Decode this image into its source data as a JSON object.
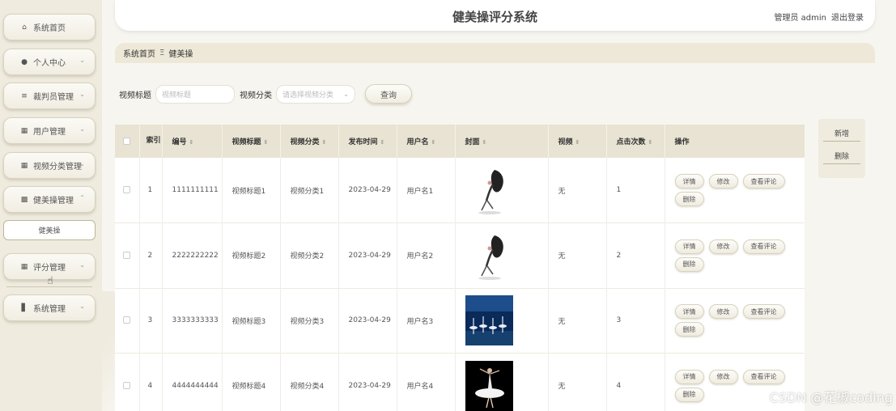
{
  "header": {
    "title": "健美操评分系统",
    "user_label": "管理员 admin",
    "logout": "退出登录"
  },
  "sidebar": {
    "items": [
      {
        "label": "系统首页",
        "icon": "home-icon"
      },
      {
        "label": "个人中心",
        "icon": "user-icon"
      },
      {
        "label": "裁判员管理",
        "icon": "list-icon"
      },
      {
        "label": "用户管理",
        "icon": "grid-icon"
      },
      {
        "label": "视频分类管理",
        "icon": "grid-icon"
      },
      {
        "label": "健美操管理",
        "icon": "clipboard-icon"
      },
      {
        "label": "评分管理",
        "icon": "grid-icon"
      },
      {
        "label": "系统管理",
        "icon": "bar-chart-icon"
      }
    ],
    "sub_item": "健美操"
  },
  "breadcrumb": {
    "home": "系统首页",
    "separator": "Ξ",
    "current": "健美操"
  },
  "search": {
    "title_label": "视频标题",
    "title_placeholder": "视频标题",
    "category_label": "视频分类",
    "category_placeholder": "请选择视频分类",
    "query_button": "查询"
  },
  "actions": {
    "add": "新增",
    "delete": "删除"
  },
  "table": {
    "headers": {
      "index": "索引",
      "code": "编号",
      "title": "视频标题",
      "category": "视频分类",
      "date": "发布时间",
      "username": "用户名",
      "cover": "封面",
      "video": "视频",
      "clicks": "点击次数",
      "ops": "操作"
    },
    "op_labels": {
      "detail": "详情",
      "edit": "修改",
      "comments": "查看评论",
      "delete": "删除"
    },
    "rows": [
      {
        "index": "1",
        "code": "1111111111",
        "title": "视频标题1",
        "category": "视频分类1",
        "date": "2023-04-29",
        "username": "用户名1",
        "video": "无",
        "clicks": "1",
        "cover": "dancer-white-bg"
      },
      {
        "index": "2",
        "code": "2222222222",
        "title": "视频标题2",
        "category": "视频分类2",
        "date": "2023-04-29",
        "username": "用户名2",
        "video": "无",
        "clicks": "2",
        "cover": "dancer-white-bg"
      },
      {
        "index": "3",
        "code": "3333333333",
        "title": "视频标题3",
        "category": "视频分类3",
        "date": "2023-04-29",
        "username": "用户名3",
        "video": "无",
        "clicks": "3",
        "cover": "ballet-stage-blue"
      },
      {
        "index": "4",
        "code": "4444444444",
        "title": "视频标题4",
        "category": "视频分类4",
        "date": "2023-04-29",
        "username": "用户名4",
        "video": "无",
        "clicks": "4",
        "cover": "ballerina-black-bg"
      }
    ]
  },
  "watermark": "CSDN @花椒coding"
}
